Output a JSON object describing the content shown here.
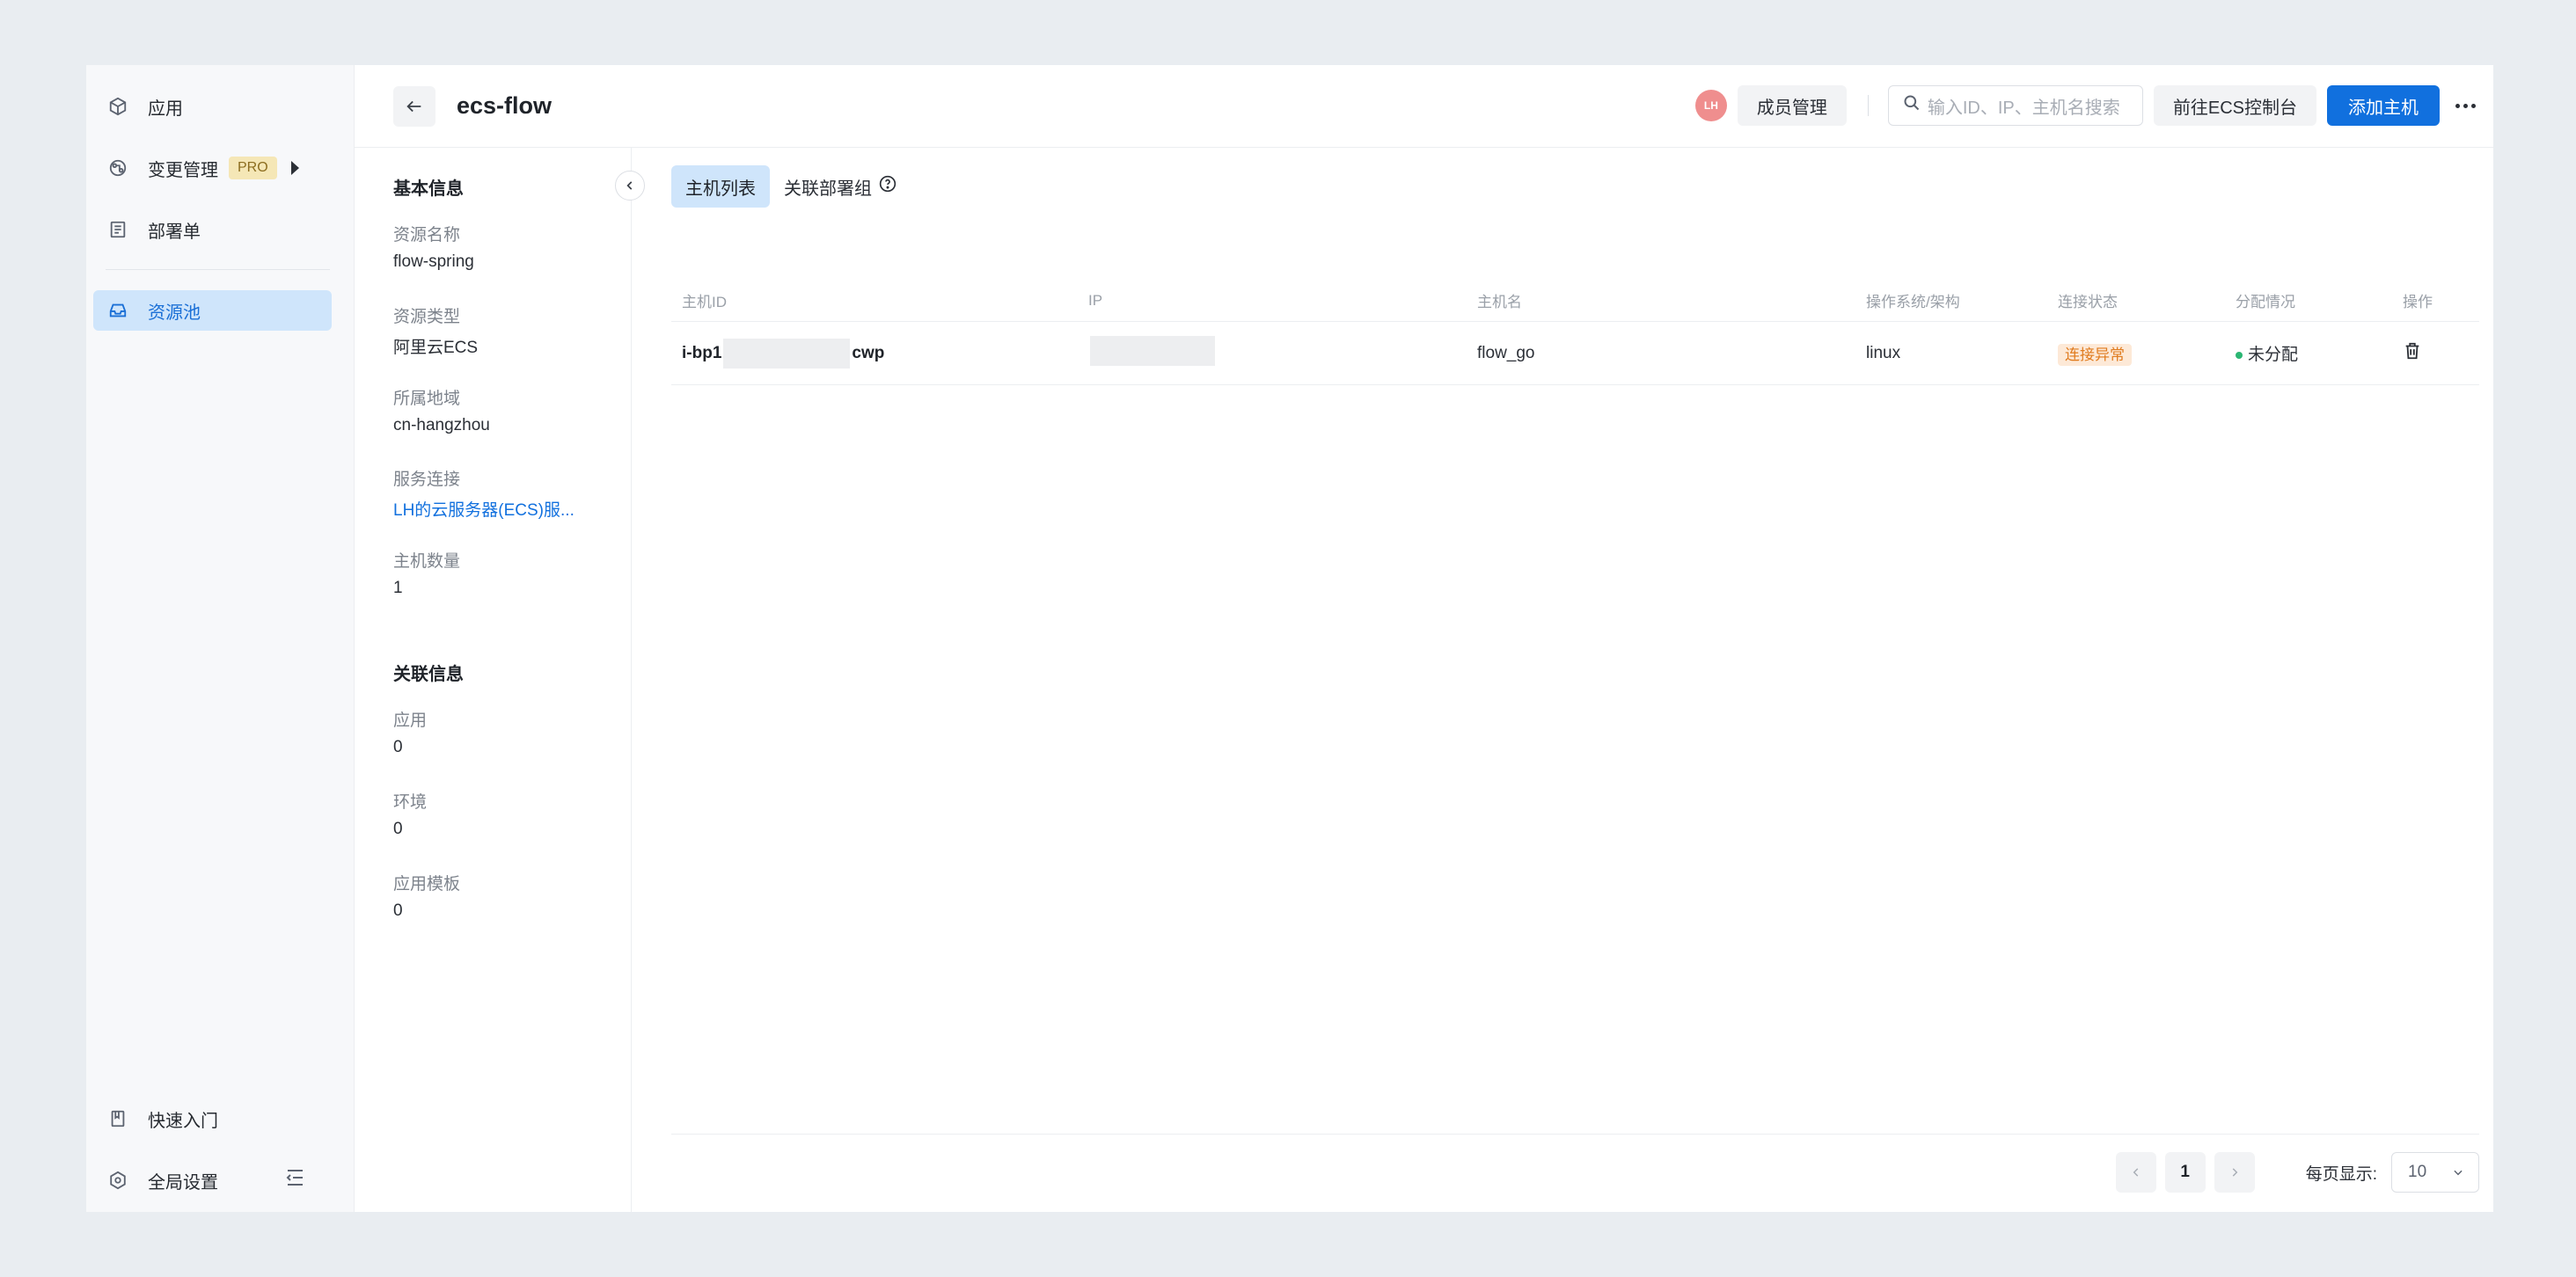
{
  "nav": {
    "items": [
      {
        "label": "应用",
        "icon": "cube-icon"
      },
      {
        "label": "变更管理",
        "badge": "PRO",
        "icon": "flow-icon"
      },
      {
        "label": "部署单",
        "icon": "list-icon"
      },
      {
        "label": "资源池",
        "icon": "inbox-icon"
      }
    ],
    "bottom": [
      {
        "label": "快速入门",
        "icon": "book-icon"
      },
      {
        "label": "全局设置",
        "icon": "gear-icon"
      }
    ]
  },
  "header": {
    "title": "ecs-flow",
    "avatar": "LH",
    "members_btn": "成员管理",
    "search_placeholder": "输入ID、IP、主机名搜索",
    "console_btn": "前往ECS控制台",
    "add_btn": "添加主机"
  },
  "info": {
    "basic_title": "基本信息",
    "fields": [
      {
        "label": "资源名称",
        "value": "flow-spring"
      },
      {
        "label": "资源类型",
        "value": "阿里云ECS"
      },
      {
        "label": "所属地域",
        "value": "cn-hangzhou"
      },
      {
        "label": "服务连接",
        "value": "LH的云服务器(ECS)服..."
      },
      {
        "label": "主机数量",
        "value": "1"
      }
    ],
    "related_title": "关联信息",
    "related": [
      {
        "label": "应用",
        "value": "0"
      },
      {
        "label": "环境",
        "value": "0"
      },
      {
        "label": "应用模板",
        "value": "0"
      }
    ]
  },
  "tabs": [
    {
      "label": "主机列表",
      "active": true
    },
    {
      "label": "关联部署组",
      "active": false
    }
  ],
  "table": {
    "columns": [
      "主机ID",
      "IP",
      "主机名",
      "操作系统/架构",
      "连接状态",
      "分配情况",
      "操作"
    ],
    "rows": [
      {
        "id_prefix": "i-bp1",
        "id_suffix": "cwp",
        "ip": "",
        "hostname": "flow_go",
        "os": "linux",
        "status": "连接异常",
        "allocation": "未分配"
      }
    ]
  },
  "pagination": {
    "current": "1",
    "page_size_label": "每页显示:",
    "page_size": "10"
  },
  "colors": {
    "primary": "#1170de",
    "active_bg": "#cfe5fb",
    "warn_bg": "#fde9d7",
    "warn_text": "#e07b1e",
    "ok_dot": "#2bb673"
  }
}
